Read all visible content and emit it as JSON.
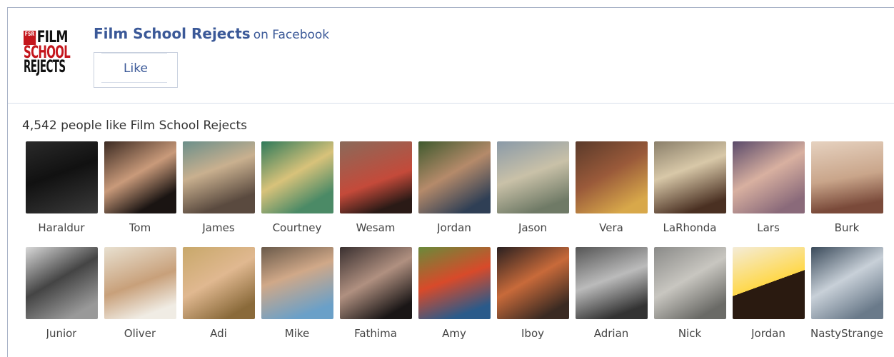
{
  "page": {
    "logo_text": [
      "FILM",
      "SCHOOL",
      "REJECTS"
    ],
    "logo_mark": "FSR",
    "name": "Film School Rejects",
    "on_facebook": "on Facebook",
    "like_label": "Like"
  },
  "likes_summary": "4,542 people like Film School Rejects",
  "colors": {
    "facebook_blue": "#3b5998",
    "border": "#aab4c8",
    "logo_red": "#c4161c"
  },
  "faces_rows": [
    [
      {
        "name": "Haraldur",
        "bg": "linear-gradient(160deg,#2a2a2a,#111 45%,#3a3a3a)"
      },
      {
        "name": "Tom",
        "bg": "linear-gradient(150deg,#3b2a22,#c99a7a 45%,#1a1412 80%)"
      },
      {
        "name": "James",
        "bg": "linear-gradient(160deg,#6b8f8a,#c9b08f 40%,#5a4a3f 80%)"
      },
      {
        "name": "Courtney",
        "bg": "linear-gradient(150deg,#2e7a5a,#d8c27a 45%,#4b8a66 80%)"
      },
      {
        "name": "Wesam",
        "bg": "linear-gradient(160deg,#8a6a5a,#c44a3a 55%,#2a1a16 85%)"
      },
      {
        "name": "Jordan",
        "bg": "linear-gradient(150deg,#3f5a2e,#b58a6a 45%,#2f3f55 85%)"
      },
      {
        "name": "Jason",
        "bg": "linear-gradient(160deg,#8a9aa8,#c9c1a8 45%,#6f7a66 85%)"
      },
      {
        "name": "Vera",
        "bg": "linear-gradient(150deg,#5a3a2a,#9a5a3a 45%,#d8a84a 85%)"
      },
      {
        "name": "LaRhonda",
        "bg": "linear-gradient(160deg,#8a7f6a,#d8c8a8 40%,#4a3022 85%)"
      },
      {
        "name": "Lars",
        "bg": "linear-gradient(150deg,#5a4a6a,#d8b0a0 45%,#8a6a7a 85%)"
      },
      {
        "name": "Burk",
        "bg": "linear-gradient(170deg,#e6d2c0,#c9a58a 50%,#7a4a3a 85%)"
      }
    ],
    [
      {
        "name": "Junior",
        "bg": "linear-gradient(150deg,#d8d8d8,#444 45%,#999 85%)"
      },
      {
        "name": "Oliver",
        "bg": "linear-gradient(160deg,#e8e0d0,#c8a07a 50%,#f0ece4 85%)"
      },
      {
        "name": "Adi",
        "bg": "linear-gradient(150deg,#c8a86a,#e0b890 45%,#8a6a3a 85%)"
      },
      {
        "name": "Mike",
        "bg": "linear-gradient(160deg,#6a5a4a,#d0a888 40%,#6aa0c8 85%)"
      },
      {
        "name": "Fathima",
        "bg": "linear-gradient(150deg,#3a3030,#b09080 45%,#1a1616 85%)"
      },
      {
        "name": "Amy",
        "bg": "linear-gradient(160deg,#6a8a3a,#d84a2a 45%,#2a5a8a 85%)"
      },
      {
        "name": "Iboy",
        "bg": "linear-gradient(150deg,#2a2020,#c86a3a 45%,#3a2a22 85%)"
      },
      {
        "name": "Adrian",
        "bg": "linear-gradient(160deg,#555,#bbb 45%,#333 85%)"
      },
      {
        "name": "Nick",
        "bg": "linear-gradient(150deg,#8a8a88,#c8c6c0 45%,#6a6a66 85%)"
      },
      {
        "name": "Jordan",
        "bg": "linear-gradient(160deg,#f4ecd8,#ffd84a 50%,#2a1a10 20%)"
      },
      {
        "name": "NastyStrange",
        "bg": "linear-gradient(150deg,#3a4a5a,#c8d0d8 45%,#6a7a8a 85%)"
      }
    ]
  ]
}
